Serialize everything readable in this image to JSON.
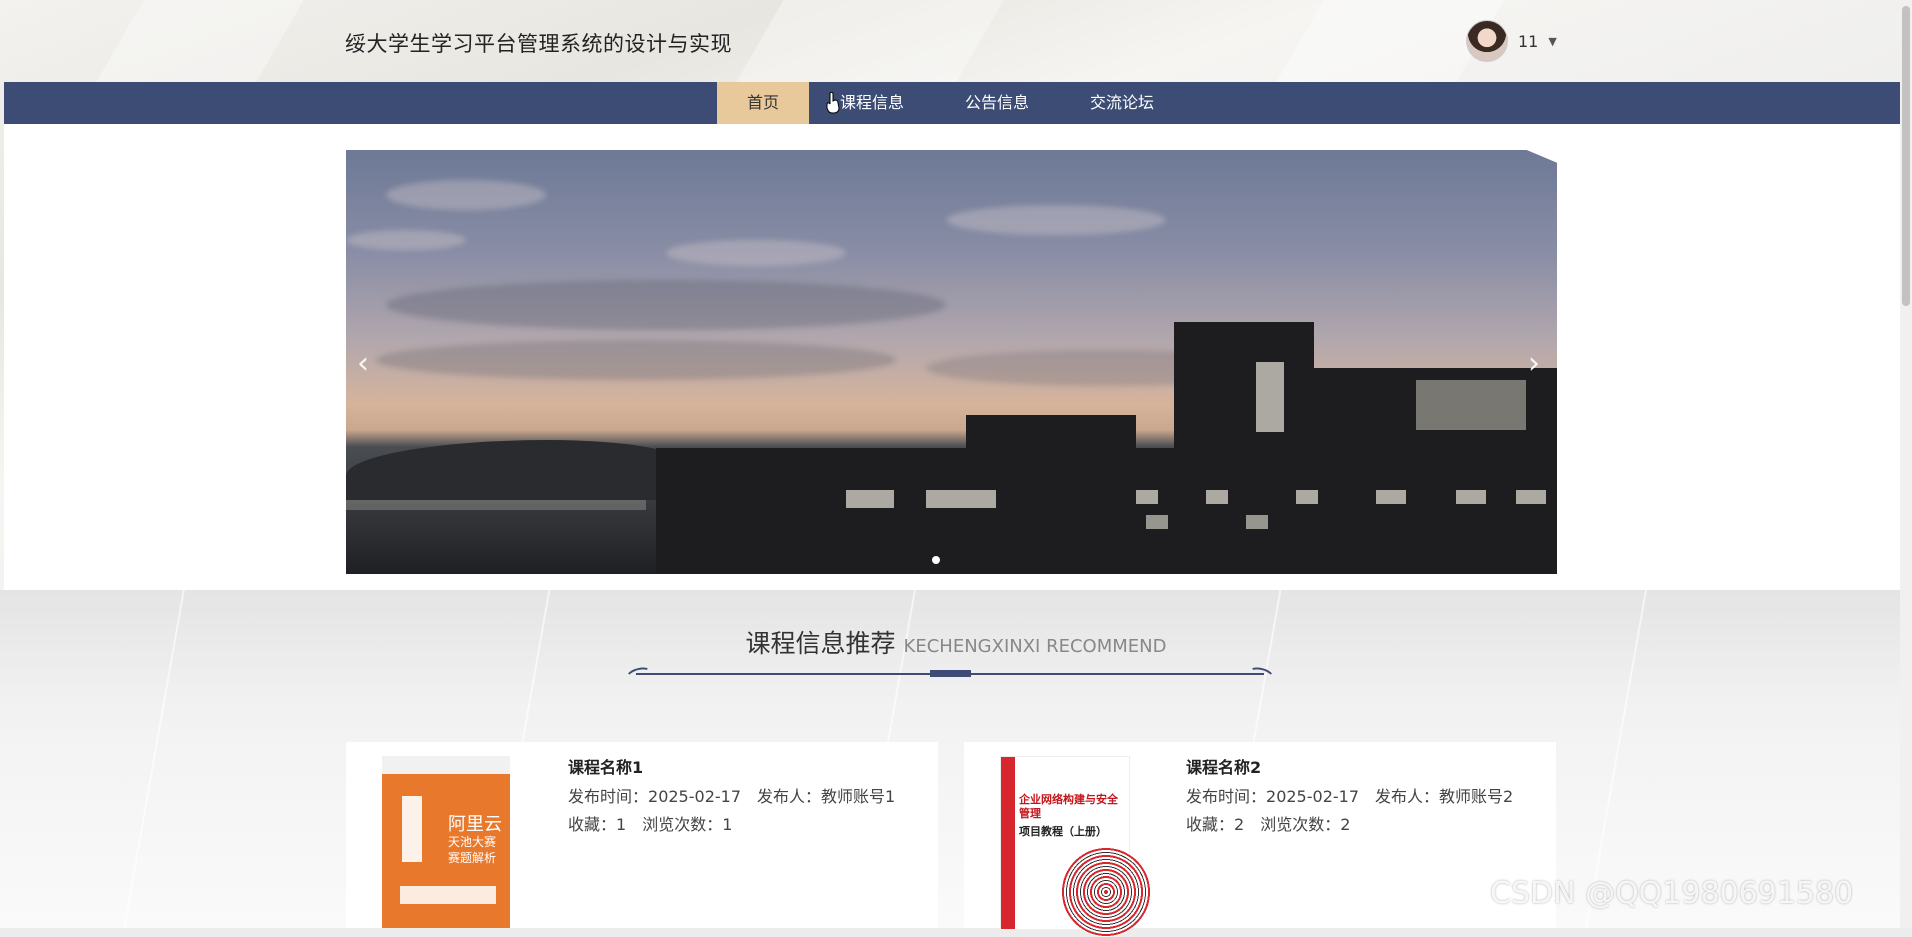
{
  "header": {
    "title": "绥大学生学习平台管理系统的设计与实现",
    "user": {
      "name": "11",
      "caret": "▼"
    }
  },
  "nav": {
    "items": [
      {
        "label": "首页",
        "active": true
      },
      {
        "label": "课程信息",
        "active": false
      },
      {
        "label": "公告信息",
        "active": false
      },
      {
        "label": "交流论坛",
        "active": false
      }
    ]
  },
  "carousel": {
    "prev_icon": "‹",
    "next_icon": "›",
    "active_slide": 1,
    "slide_count": 1
  },
  "section": {
    "title_cn": "课程信息推荐",
    "title_en": "KECHENGXINXI RECOMMEND"
  },
  "courses": [
    {
      "title": "课程名称1",
      "publish_time_label": "发布时间：",
      "publish_time": "2025-02-17",
      "publisher_label": "发布人：",
      "publisher": "教师账号1",
      "favorites_label": "收藏：",
      "favorites": "1",
      "views_label": "浏览次数：",
      "views": "1",
      "cover": {
        "title": "阿里云",
        "subtitle": "天池大赛\n赛题解析"
      }
    },
    {
      "title": "课程名称2",
      "publish_time_label": "发布时间：",
      "publish_time": "2025-02-17",
      "publisher_label": "发布人：",
      "publisher": "教师账号2",
      "favorites_label": "收藏：",
      "favorites": "2",
      "views_label": "浏览次数：",
      "views": "2",
      "cover": {
        "title": "企业网络构建与安全管理",
        "subtitle": "项目教程（上册）"
      }
    }
  ],
  "watermark": "CSDN @QQ1980691580",
  "colors": {
    "nav_bg": "#3d4c74",
    "nav_active_bg": "#e8c99c",
    "text_dark": "#222222"
  }
}
